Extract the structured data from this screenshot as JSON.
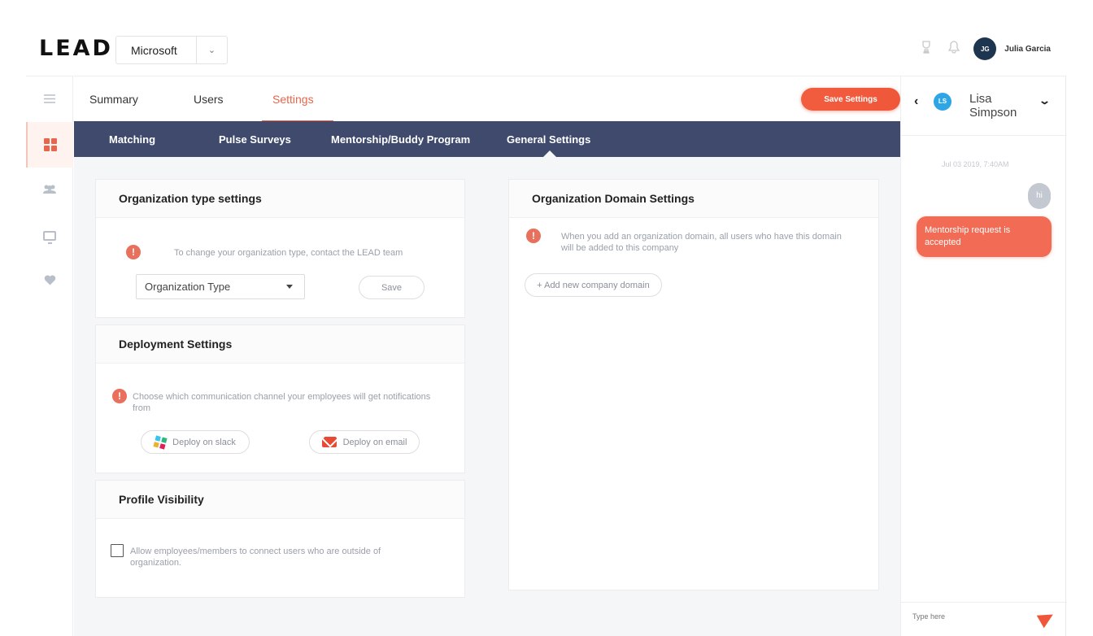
{
  "header": {
    "logo": "LEAD",
    "company_select": {
      "value": "Microsoft"
    },
    "user": {
      "initials": "JG",
      "name": "Julia Garcia"
    }
  },
  "sidebar": {
    "items": [
      {
        "icon": "menu-icon"
      },
      {
        "icon": "dashboard-icon",
        "active": true
      },
      {
        "icon": "users-icon"
      },
      {
        "icon": "monitor-icon"
      },
      {
        "icon": "heart-icon"
      }
    ]
  },
  "tabs": {
    "items": [
      "Summary",
      "Users",
      "Settings"
    ],
    "active": "Settings",
    "save_label": "Save Settings"
  },
  "subnav": {
    "items": [
      "Matching",
      "Pulse Surveys",
      "Mentorship/Buddy Program",
      "General Settings"
    ],
    "active": "General Settings"
  },
  "org_type": {
    "title": "Organization type settings",
    "notice": "To change your organization type, contact the LEAD team",
    "dropdown_value": "Organization Type",
    "save_label": "Save"
  },
  "deployment": {
    "title": "Deployment Settings",
    "notice": "Choose which communication channel your employees will get notifications from",
    "slack_label": "Deploy on slack",
    "email_label": "Deploy on email"
  },
  "profile_visibility": {
    "title": "Profile Visibility",
    "checkbox_label": "Allow employees/members to connect users who are outside of organization."
  },
  "domain": {
    "title": "Organization Domain Settings",
    "notice": "When you add an organization domain, all users who have this domain will be added to this company",
    "add_label": "+ Add new company domain"
  },
  "chat": {
    "contact": {
      "initials": "LS",
      "name": "Lisa Simpson"
    },
    "date": "Jul 03 2019, 7:40AM",
    "messages": [
      {
        "text": "hi",
        "side": "right"
      },
      {
        "text": "Mentorship request is accepted",
        "side": "left"
      }
    ],
    "input_placeholder": "Type here"
  },
  "colors": {
    "accent": "#e8664b",
    "save_button": "#f0573a",
    "subnav_bg": "#3f4a6d",
    "chat_bubble": "#f26b55",
    "avatar_bg": "#1e3550"
  }
}
